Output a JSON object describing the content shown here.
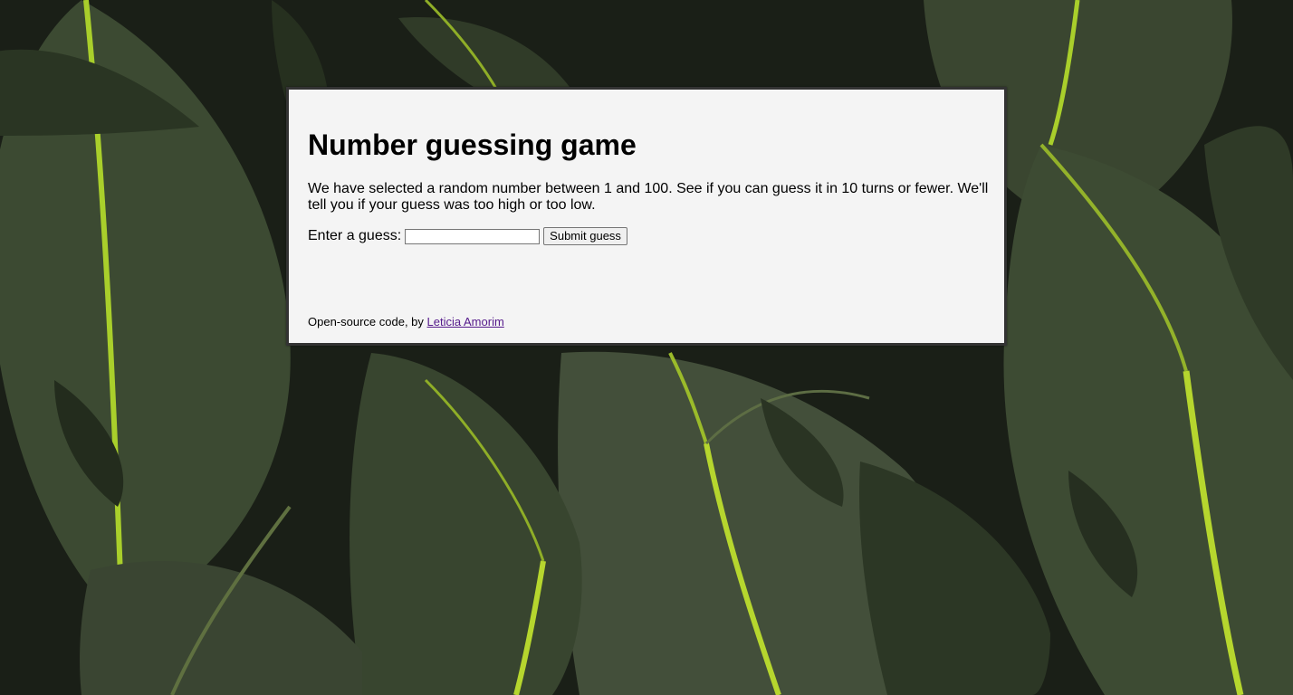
{
  "colors": {
    "card_background": "#f4f4f4",
    "card_border": "#333333",
    "visited_link": "#551a8b",
    "leaf_dark": "#2e3a26",
    "leaf_vein": "#b6d62e",
    "background_dark": "#1a1f17"
  },
  "background": {
    "description_icon": "leaf-pattern-background"
  },
  "game": {
    "title": "Number guessing game",
    "intro": "We have selected a random number between 1 and 100. See if you can guess it in 10 turns or fewer. We'll tell you if your guess was too high or too low.",
    "guess_label": "Enter a guess:",
    "guess_value": "",
    "submit_label": "Submit guess"
  },
  "footer": {
    "prefix": "Open-source code, by ",
    "author_link": "Leticia Amorim"
  }
}
